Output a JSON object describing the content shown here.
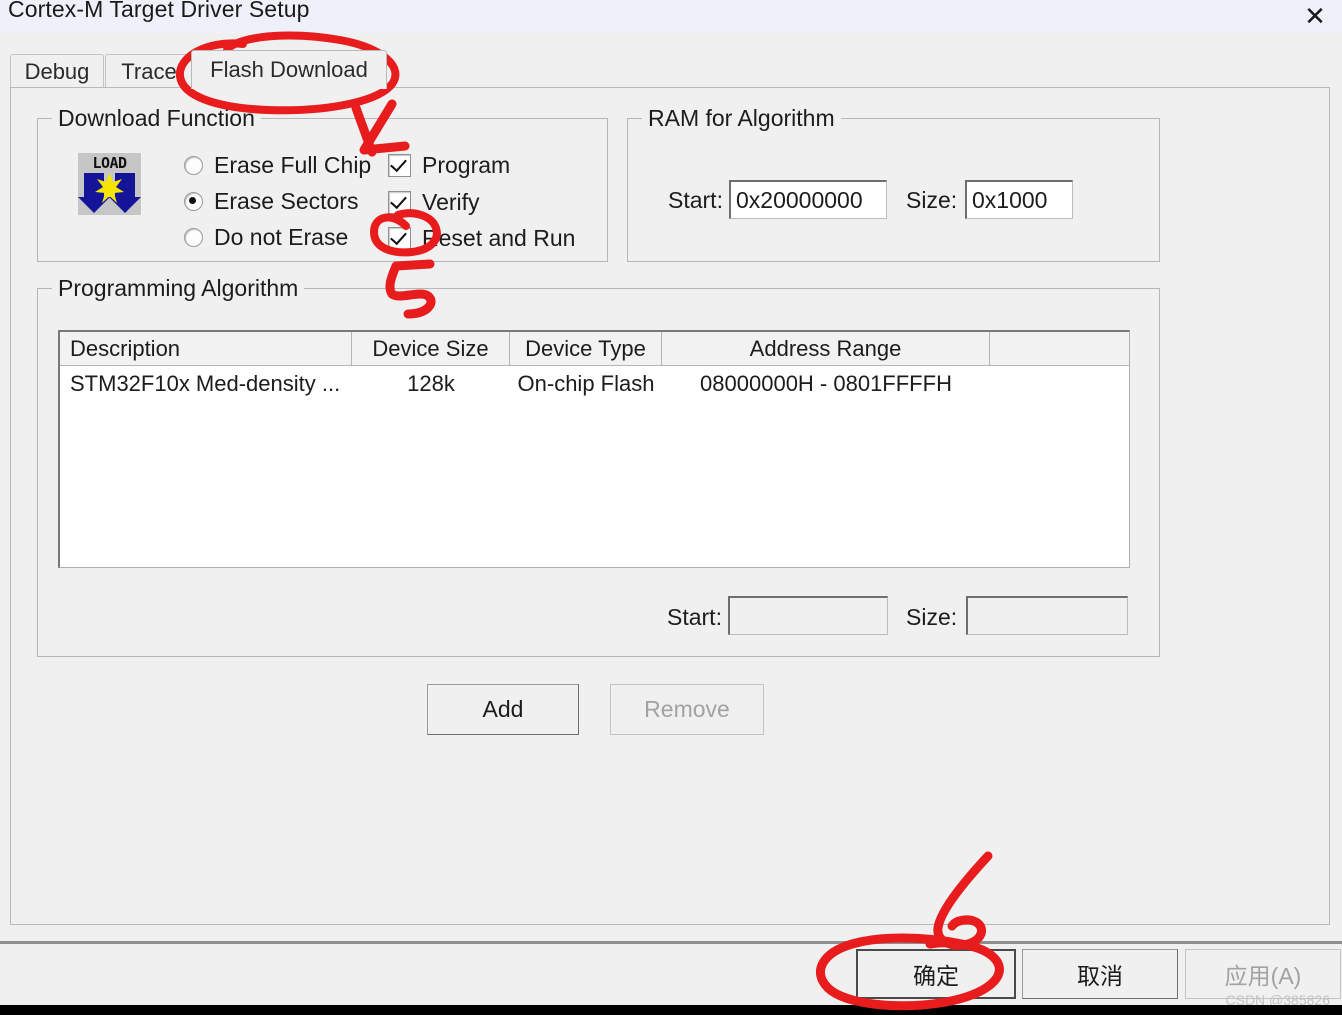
{
  "window": {
    "title": "Cortex-M Target Driver Setup",
    "close_icon": "close-icon"
  },
  "tabs": [
    {
      "label": "Debug",
      "selected": false
    },
    {
      "label": "Trace",
      "selected": false
    },
    {
      "label": "Flash Download",
      "selected": true
    }
  ],
  "download_function": {
    "legend": "Download Function",
    "icon_text": "LOAD",
    "icon_name": "load-flash-icon",
    "radios": [
      {
        "label": "Erase Full Chip",
        "checked": false
      },
      {
        "label": "Erase Sectors",
        "checked": true
      },
      {
        "label": "Do not Erase",
        "checked": false
      }
    ],
    "checkboxes": [
      {
        "label": "Program",
        "checked": true
      },
      {
        "label": "Verify",
        "checked": true
      },
      {
        "label": "Reset and Run",
        "checked": true
      }
    ]
  },
  "ram_for_algorithm": {
    "legend": "RAM for Algorithm",
    "start_label": "Start:",
    "start_value": "0x20000000",
    "size_label": "Size:",
    "size_value": "0x1000"
  },
  "programming_algorithm": {
    "legend": "Programming Algorithm",
    "columns": [
      "Description",
      "Device Size",
      "Device Type",
      "Address Range",
      ""
    ],
    "rows": [
      {
        "description": "STM32F10x Med-density ...",
        "device_size": "128k",
        "device_type": "On-chip Flash",
        "address_range": "08000000H - 0801FFFFH",
        "extra": ""
      }
    ],
    "start_label": "Start:",
    "start_value": "",
    "size_label": "Size:",
    "size_value": ""
  },
  "actions": {
    "add_label": "Add",
    "remove_label": "Remove",
    "remove_disabled": true
  },
  "dialog_buttons": {
    "ok_label": "确定",
    "cancel_label": "取消",
    "apply_label": "应用(A)",
    "apply_disabled": true
  },
  "annotations": [
    {
      "name": "annotation-circle-flash-download",
      "shape": "ellipse",
      "note": "red ellipse around Flash Download tab"
    },
    {
      "name": "annotation-digit-4",
      "shape": "digit",
      "text": "4"
    },
    {
      "name": "annotation-circle-reset-and-run",
      "shape": "ellipse",
      "note": "red circle around Reset and Run checkbox"
    },
    {
      "name": "annotation-digit-5",
      "shape": "digit",
      "text": "5"
    },
    {
      "name": "annotation-digit-6",
      "shape": "digit",
      "text": "6"
    },
    {
      "name": "annotation-circle-ok-button",
      "shape": "ellipse",
      "note": "red circle around 确定 button"
    }
  ],
  "watermark": {
    "text": "CSDN @385826"
  },
  "colors": {
    "window_bg": "#f0f0f0",
    "titlebar_bg": "#eef1f9",
    "annotation_red": "#e81c1c",
    "field_bg": "#ffffff",
    "border": "#b6b6b6"
  }
}
